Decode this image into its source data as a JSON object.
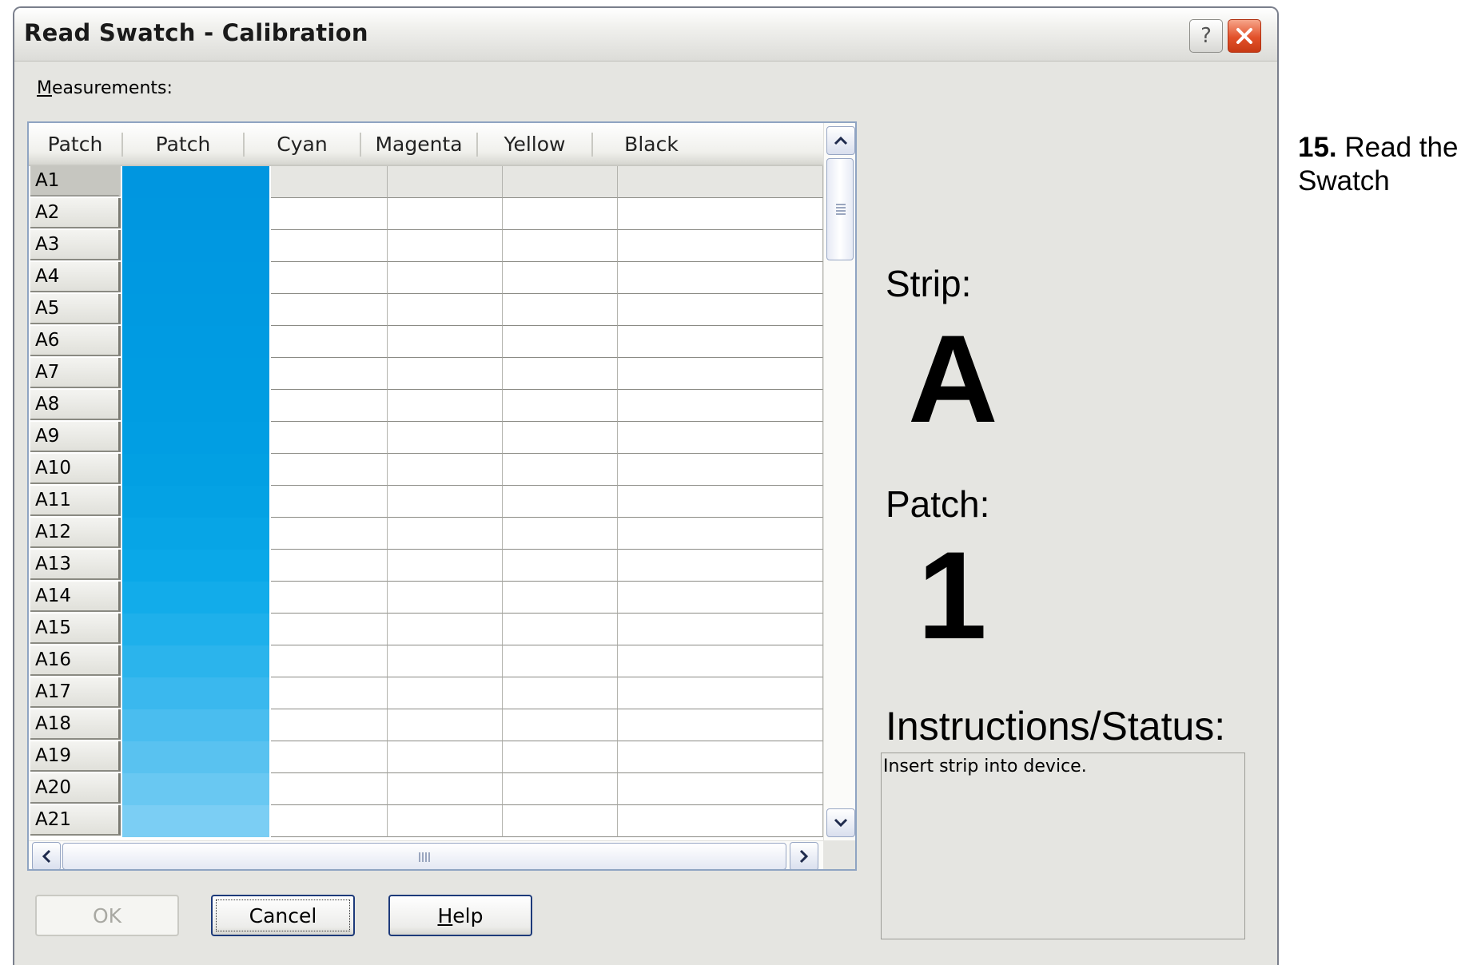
{
  "window": {
    "title": "Read Swatch - Calibration",
    "help_button_label": "?",
    "close_icon": "close-icon"
  },
  "measurements_label": "Measurements:",
  "measurements_label_underline": "M",
  "measurements_label_rest": "easurements:",
  "table": {
    "columns": [
      "Patch",
      "Patch",
      "Cyan",
      "Magenta",
      "Yellow",
      "Black"
    ],
    "selected_row": "A1",
    "rows": [
      {
        "id": "A1",
        "swatch": "#0096e0"
      },
      {
        "id": "A2",
        "swatch": "#0097e0"
      },
      {
        "id": "A3",
        "swatch": "#0098e1"
      },
      {
        "id": "A4",
        "swatch": "#0099e1"
      },
      {
        "id": "A5",
        "swatch": "#009ae1"
      },
      {
        "id": "A6",
        "swatch": "#009be2"
      },
      {
        "id": "A7",
        "swatch": "#009ce2"
      },
      {
        "id": "A8",
        "swatch": "#009de2"
      },
      {
        "id": "A9",
        "swatch": "#019ee3"
      },
      {
        "id": "A10",
        "swatch": "#02a0e3"
      },
      {
        "id": "A11",
        "swatch": "#04a2e4"
      },
      {
        "id": "A12",
        "swatch": "#07a5e6"
      },
      {
        "id": "A13",
        "swatch": "#0aa8e8"
      },
      {
        "id": "A14",
        "swatch": "#12acea"
      },
      {
        "id": "A15",
        "swatch": "#1eb0eb"
      },
      {
        "id": "A16",
        "swatch": "#2bb4ec"
      },
      {
        "id": "A17",
        "swatch": "#3ab8ee"
      },
      {
        "id": "A18",
        "swatch": "#4abdef"
      },
      {
        "id": "A19",
        "swatch": "#59c2f0"
      },
      {
        "id": "A20",
        "swatch": "#69c8f2"
      },
      {
        "id": "A21",
        "swatch": "#7bcef4"
      }
    ]
  },
  "buttons": {
    "ok": "OK",
    "cancel": "Cancel",
    "help_underline": "H",
    "help_rest": "elp"
  },
  "strip": {
    "label": "Strip:",
    "value": "A"
  },
  "patch": {
    "label": "Patch:",
    "value": "1"
  },
  "status": {
    "label": "Instructions/Status:",
    "text": "Insert strip into device."
  },
  "caption": {
    "step": "15.",
    "text": "Read the Swatch"
  },
  "colors": {
    "dialog_bg": "#e5e5e1",
    "button_border": "#1d3a7a",
    "close_button": "#e2512a"
  }
}
